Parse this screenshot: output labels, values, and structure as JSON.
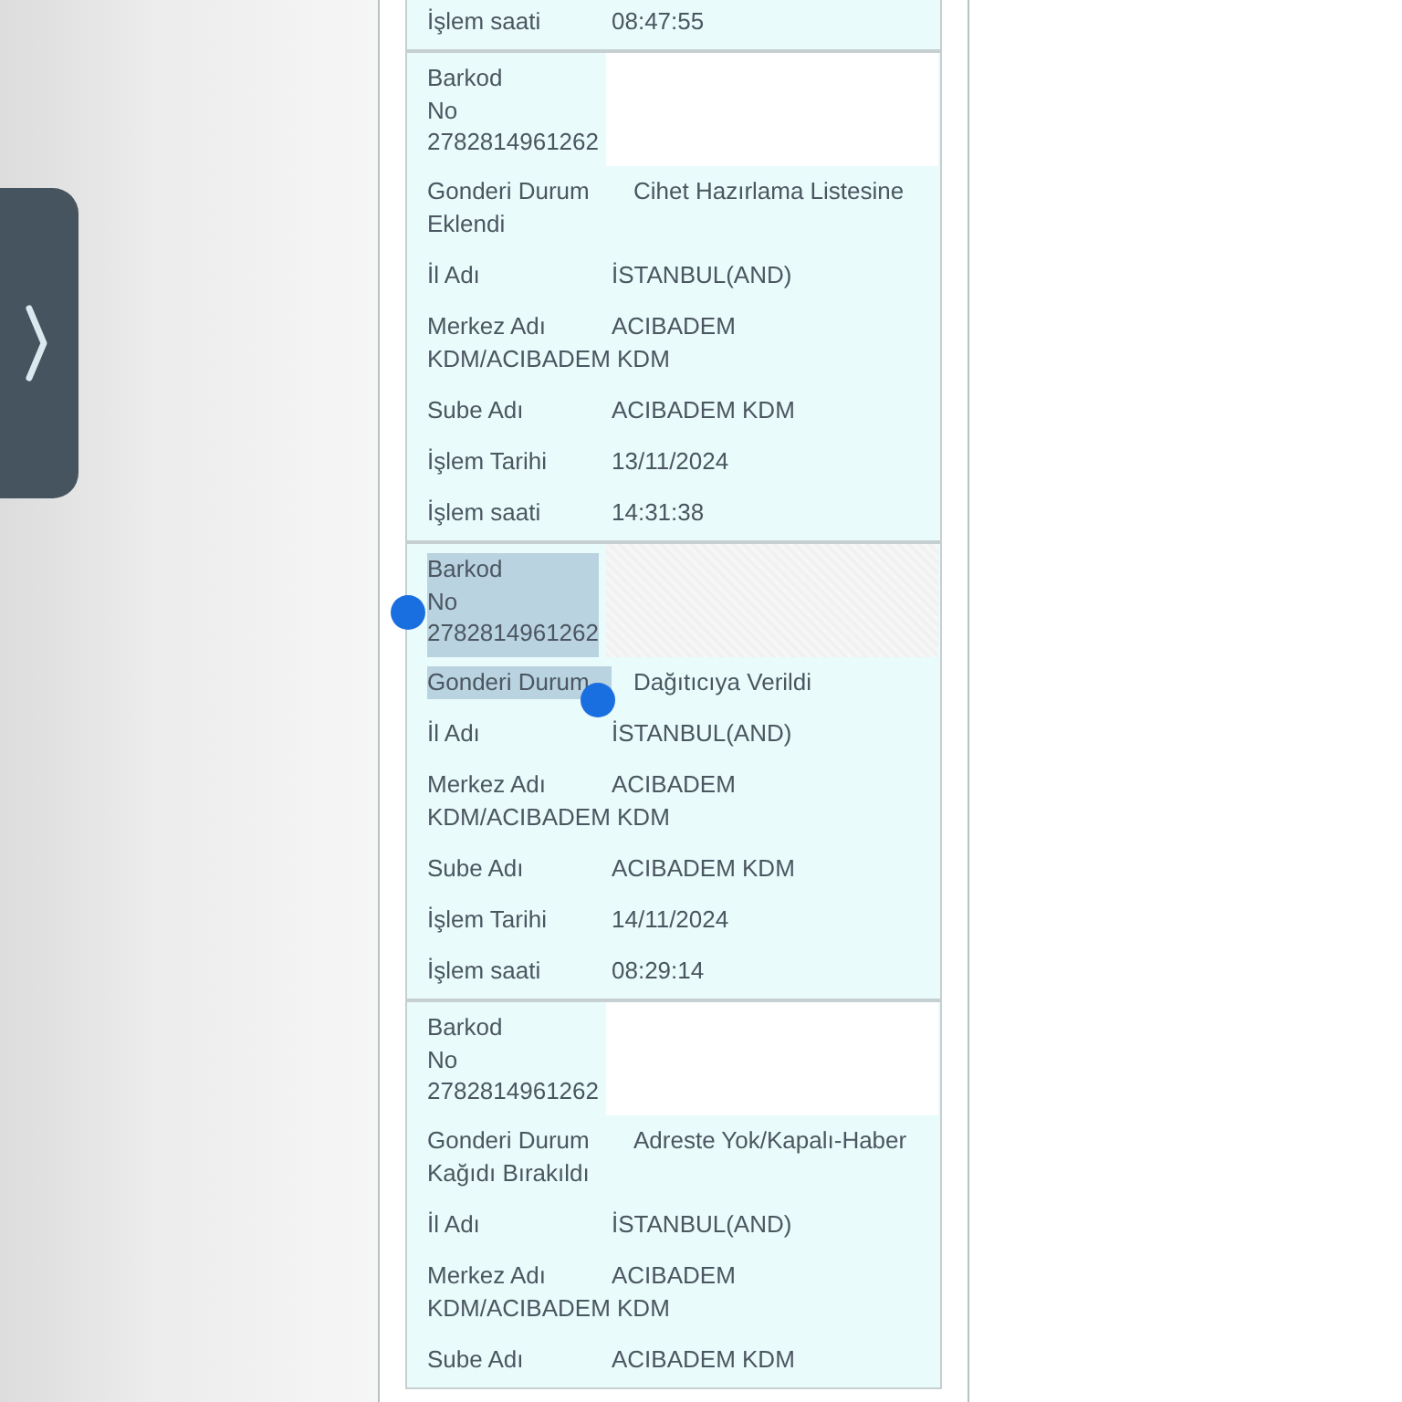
{
  "records": [
    {
      "fields": [
        {
          "kind": "text",
          "selected": false,
          "label": "İşlem saati",
          "value": "08:47:55"
        }
      ]
    },
    {
      "fields": [
        {
          "kind": "barcode",
          "selected": false,
          "label": "Barkod\nNo\n2782814961262"
        },
        {
          "kind": "text",
          "selected": false,
          "label": "Gonderi Durum",
          "value": "Cihet Hazırlama Listesine Eklendi"
        },
        {
          "kind": "text",
          "selected": false,
          "label": "İl Adı",
          "value": "İSTANBUL(AND)"
        },
        {
          "kind": "text",
          "selected": false,
          "label": "Merkez Adı",
          "value": "ACIBADEM KDM/ACIBADEM KDM"
        },
        {
          "kind": "text",
          "selected": false,
          "label": "Sube Adı",
          "value": "ACIBADEM KDM"
        },
        {
          "kind": "text",
          "selected": false,
          "label": "İşlem Tarihi",
          "value": "13/11/2024"
        },
        {
          "kind": "text",
          "selected": false,
          "label": "İşlem saati",
          "value": "14:31:38"
        }
      ]
    },
    {
      "fields": [
        {
          "kind": "barcode",
          "selected": true,
          "label": "Barkod\nNo\n2782814961262"
        },
        {
          "kind": "text",
          "selected": true,
          "label": "Gonderi Durum",
          "value": "Dağıtıcıya Verildi"
        },
        {
          "kind": "text",
          "selected": false,
          "label": "İl Adı",
          "value": "İSTANBUL(AND)"
        },
        {
          "kind": "text",
          "selected": false,
          "label": "Merkez Adı",
          "value": "ACIBADEM KDM/ACIBADEM KDM"
        },
        {
          "kind": "text",
          "selected": false,
          "label": "Sube Adı",
          "value": "ACIBADEM KDM"
        },
        {
          "kind": "text",
          "selected": false,
          "label": "İşlem Tarihi",
          "value": "14/11/2024"
        },
        {
          "kind": "text",
          "selected": false,
          "label": "İşlem saati",
          "value": "08:29:14"
        }
      ]
    },
    {
      "fields": [
        {
          "kind": "barcode",
          "selected": false,
          "label": "Barkod\nNo\n2782814961262"
        },
        {
          "kind": "text",
          "selected": false,
          "label": "Gonderi Durum",
          "value": "Adreste Yok/Kapalı-Haber Kağıdı Bırakıldı"
        },
        {
          "kind": "text",
          "selected": false,
          "label": "İl Adı",
          "value": "İSTANBUL(AND)"
        },
        {
          "kind": "text",
          "selected": false,
          "label": "Merkez Adı",
          "value": "ACIBADEM KDM/ACIBADEM KDM"
        },
        {
          "kind": "text",
          "selected": false,
          "label": "Sube Adı",
          "value": "ACIBADEM KDM"
        }
      ]
    }
  ]
}
